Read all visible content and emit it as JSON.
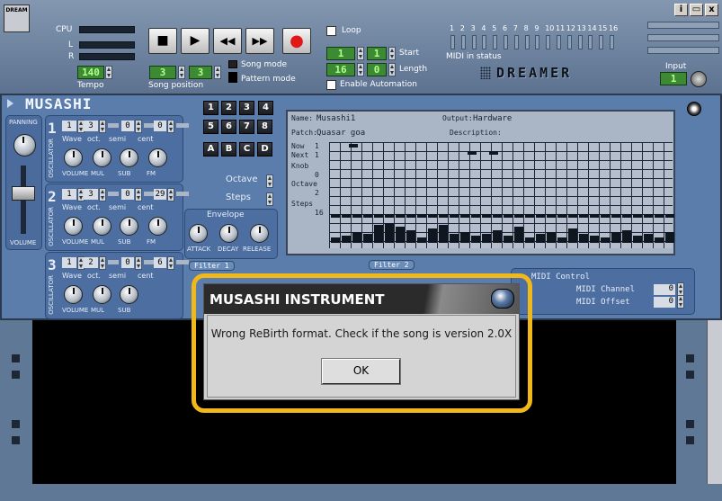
{
  "titlebar": {
    "icon_label": "DREAM",
    "info_btn": "i",
    "close_btn": "x"
  },
  "transport": {
    "cpu_label": "CPU",
    "l_label": "L",
    "r_label": "R",
    "tempo_value": "140",
    "tempo_label": "Tempo",
    "songpos_bar": "3",
    "songpos_beat": "3",
    "songpos_label": "Song position",
    "song_mode": "Song mode",
    "pattern_mode": "Pattern mode",
    "stop": "■",
    "play": "▶",
    "rewind": "◀◀",
    "ffwd": "▶▶",
    "record": "●",
    "loop_label": "Loop",
    "start_bar": "1",
    "start_beat": "1",
    "start_label": "Start",
    "length_bar": "16",
    "length_beat": "0",
    "length_label": "Length",
    "enable_automation": "Enable Automation",
    "midi_channels": [
      "1",
      "2",
      "3",
      "4",
      "5",
      "6",
      "7",
      "8",
      "9",
      "10",
      "11",
      "12",
      "13",
      "14",
      "15",
      "16"
    ],
    "midi_status_label": "MIDI in status",
    "logo": "DREAMER",
    "input_label": "Input",
    "input_value": "1"
  },
  "instrument": {
    "name": "MUSASHI",
    "panning_label": "PANNING",
    "volume_label": "VOLUME",
    "oscillators": [
      {
        "num": "1",
        "wave": "1",
        "oct": "3",
        "semi": "0",
        "cent": "0",
        "labels": [
          "Wave",
          "oct.",
          "semi",
          "cent"
        ],
        "knobs": [
          "VOLUME",
          "MUL",
          "SUB",
          "FM"
        ],
        "side": "OSCILLATOR"
      },
      {
        "num": "2",
        "wave": "1",
        "oct": "3",
        "semi": "0",
        "cent": "29",
        "labels": [
          "Wave",
          "oct.",
          "semi",
          "cent"
        ],
        "knobs": [
          "VOLUME",
          "MUL",
          "SUB",
          "FM"
        ],
        "side": "OSCILLATOR"
      },
      {
        "num": "3",
        "wave": "1",
        "oct": "2",
        "semi": "0",
        "cent": "6",
        "labels": [
          "Wave",
          "oct.",
          "semi",
          "cent"
        ],
        "knobs": [
          "VOLUME",
          "MUL",
          "SUB"
        ],
        "side": "OSCILLATOR"
      }
    ],
    "num_keys": [
      "1",
      "2",
      "3",
      "4",
      "5",
      "6",
      "7",
      "8"
    ],
    "letter_keys": [
      "A",
      "B",
      "C",
      "D"
    ],
    "octave_label": "Octave",
    "steps_label": "Steps",
    "envelope_label": "Envelope",
    "env_knobs": [
      "ATTACK",
      "DECAY",
      "RELEASE"
    ],
    "filter1_label": "Filter 1",
    "filter2_label": "Filter 2",
    "midi_control_label": "MIDI Control",
    "midi_channel_label": "MIDI Channel",
    "midi_channel_value": "0",
    "midi_offset_label": "MIDI Offset",
    "midi_offset_value": "0"
  },
  "screen": {
    "name_label": "Name:",
    "name_value": "Musashi1",
    "output_label": "Output:",
    "output_value": "Hardware",
    "patch_label": "Patch:",
    "patch_value": "Quasar goa",
    "description_label": "Description:",
    "rows": [
      {
        "label": "Now",
        "value": "1"
      },
      {
        "label": "Next",
        "value": "1"
      },
      {
        "label": "Knob",
        "value": "0"
      },
      {
        "label": "Octave",
        "value": "2"
      },
      {
        "label": "Steps",
        "value": "16"
      }
    ]
  },
  "dialog": {
    "title": "MUSASHI INSTRUMENT",
    "message": "Wrong ReBirth format. Check if the song is version 2.0X",
    "ok_label": "OK"
  }
}
